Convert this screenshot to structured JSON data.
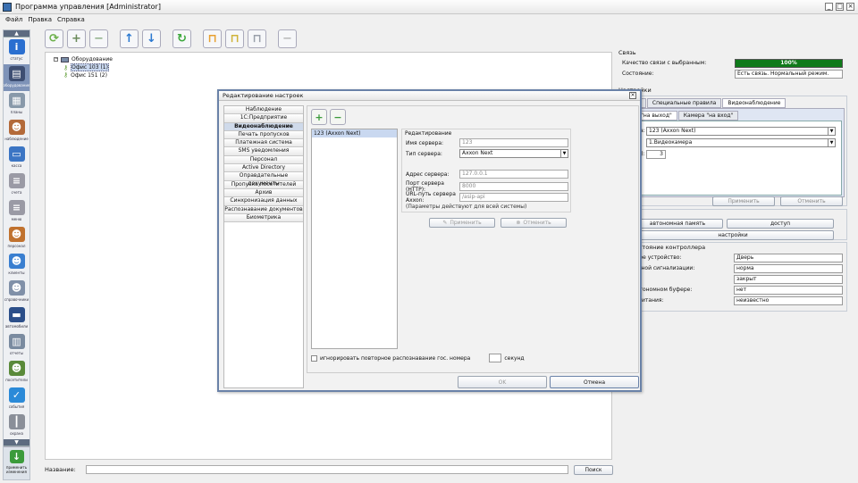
{
  "window": {
    "title": "Программа управления [Administrator]",
    "controls": [
      "_",
      "□",
      "×"
    ]
  },
  "menu": [
    "Файл",
    "Правка",
    "Справка"
  ],
  "sidebar": {
    "up_arrow": "▲",
    "down_arrow": "▼",
    "items": [
      {
        "label": "статус",
        "icon": "info-icon",
        "color": "#2a6fd0",
        "glyph": "i"
      },
      {
        "label": "оборудование",
        "icon": "hardware-icon",
        "color": "#3d4e72",
        "glyph": "▤"
      },
      {
        "label": "планы",
        "icon": "plans-icon",
        "color": "#8899aa",
        "glyph": "▦"
      },
      {
        "label": "наблюдение",
        "icon": "person-icon",
        "color": "#b36a3a",
        "glyph": "☻"
      },
      {
        "label": "касса",
        "icon": "cashier-icon",
        "color": "#3b75c4",
        "glyph": "▭"
      },
      {
        "label": "счета",
        "icon": "invoices-icon",
        "color": "#9a9aa5",
        "glyph": "≡"
      },
      {
        "label": "меню",
        "icon": "menu-icon",
        "color": "#9a9aa5",
        "glyph": "≡"
      },
      {
        "label": "персонал",
        "icon": "staff-icon",
        "color": "#c0722f",
        "glyph": "☻"
      },
      {
        "label": "клиенты",
        "icon": "clients-icon",
        "color": "#3a7fd0",
        "glyph": "☻"
      },
      {
        "label": "справочники",
        "icon": "directory-icon",
        "color": "#8090a8",
        "glyph": "☻"
      },
      {
        "label": "автомобили",
        "icon": "car-icon",
        "color": "#2c4f8a",
        "glyph": "▬"
      },
      {
        "label": "отчеты",
        "icon": "reports-icon",
        "color": "#7a8ba0",
        "glyph": "▥"
      },
      {
        "label": "посетители",
        "icon": "visitors-icon",
        "color": "#5a8a3a",
        "glyph": "☻"
      },
      {
        "label": "события",
        "icon": "events-icon",
        "color": "#2b8ad8",
        "glyph": "✓"
      },
      {
        "label": "охрана",
        "icon": "security-icon",
        "color": "#8a8f99",
        "glyph": "┃"
      }
    ],
    "bottom": {
      "label": "применить\nизменения",
      "icon": "download-icon"
    }
  },
  "toolbar": [
    {
      "icon": "refresh-tree-icon",
      "color": "#6cb04a",
      "glyph": "⟳"
    },
    {
      "icon": "add-device-icon",
      "color": "#6a8a5a",
      "glyph": "+"
    },
    {
      "icon": "remove-device-icon",
      "color": "#8fb08a",
      "glyph": "−"
    },
    {
      "icon": "arrow-up-icon",
      "color": "#2a78d0",
      "glyph": "↑"
    },
    {
      "icon": "arrow-down-icon",
      "color": "#2a78d0",
      "glyph": "↓"
    },
    {
      "icon": "sync-icon",
      "color": "#3ca83c",
      "glyph": "↻"
    },
    {
      "icon": "open-lock-icon",
      "color": "#e8a030",
      "glyph": "⊓"
    },
    {
      "icon": "lock-icon",
      "color": "#cfb33a",
      "glyph": "⊓"
    },
    {
      "icon": "key-lock-icon",
      "color": "#9aa0aa",
      "glyph": "⊓"
    },
    {
      "icon": "stop-icon",
      "color": "#b8b8b8",
      "glyph": "−"
    }
  ],
  "tree": {
    "root": "Оборудование",
    "items": [
      "Офис 103 (1)",
      "Офис 151 (2)"
    ]
  },
  "bottom": {
    "name_label": "Название:",
    "search_button": "Поиск"
  },
  "right": {
    "connection": {
      "title": "Связь",
      "quality_label": "Качество связи с выбранным:",
      "quality_value": "100%",
      "quality_level": 1.0,
      "state_label": "Состояние:",
      "state_value": "Есть связь. Нормальный режим."
    },
    "settings": {
      "title": "Настройки",
      "tabs": [
        "вные",
        "Специальные правила",
        "Видеонаблюдение"
      ],
      "subtabs": [
        "ера \"на выход\"",
        "Камера \"на вход\""
      ],
      "rows": [
        {
          "label": "стема:",
          "value": "123 (Axxon Next)"
        },
        {
          "label": "ера:",
          "value": "1.Видеокамера"
        },
        {
          "label": "ус (с.):",
          "value": "3"
        }
      ],
      "apply": "Применить",
      "cancel": "Отменить"
    },
    "control": {
      "title": "ление",
      "buttons": [
        "автономная память",
        "доступ",
        "настройки"
      ]
    },
    "controller": {
      "title": "ие состояние контроллера",
      "rows": [
        {
          "label": "тельное устройство:",
          "value": "Дверь"
        },
        {
          "label": "пожарной сигнализации:",
          "value": "норма"
        },
        {
          "label": ":",
          "value": "закрыт"
        },
        {
          "label": "й в автономном буфере:",
          "value": "нет"
        },
        {
          "label": "ение питания:",
          "value": "неизвестно"
        }
      ]
    }
  },
  "dialog": {
    "title": "Редактирование настроек",
    "close": "×",
    "categories": [
      "Наблюдение",
      "1С:Предприятие",
      "Видеонаблюдение",
      "Печать пропусков",
      "Платежная система",
      "SMS уведомления",
      "Персонал",
      "Active Directory",
      "Оправдательные документы",
      "Пропуска посетителей",
      "Архив",
      "Синхронизация данных",
      "Распознавание документов",
      "Биометрика"
    ],
    "selected_category": 2,
    "servers": [
      "123 (Axxon Next)"
    ],
    "edit": {
      "title": "Редактирование",
      "server_name_label": "Имя сервера:",
      "server_name": "123",
      "server_type_label": "Тип сервера:",
      "server_type": "Axxon Next",
      "address_label": "Адрес сервера:",
      "address": "127.0.0.1",
      "port_label": "Порт сервера (HTTP):",
      "port": "8000",
      "url_label": "URL-путь сервера Axxon:",
      "url": "/asip-api",
      "note": "(Параметры действуют для всей системы)"
    },
    "apply": "Применить",
    "cancel_edit": "Отменить",
    "ignore_label": "игнорировать повторное распознавание гос. номера",
    "ignore_value": "",
    "seconds": "секунд",
    "ok": "OK",
    "cancel": "Отмена"
  }
}
